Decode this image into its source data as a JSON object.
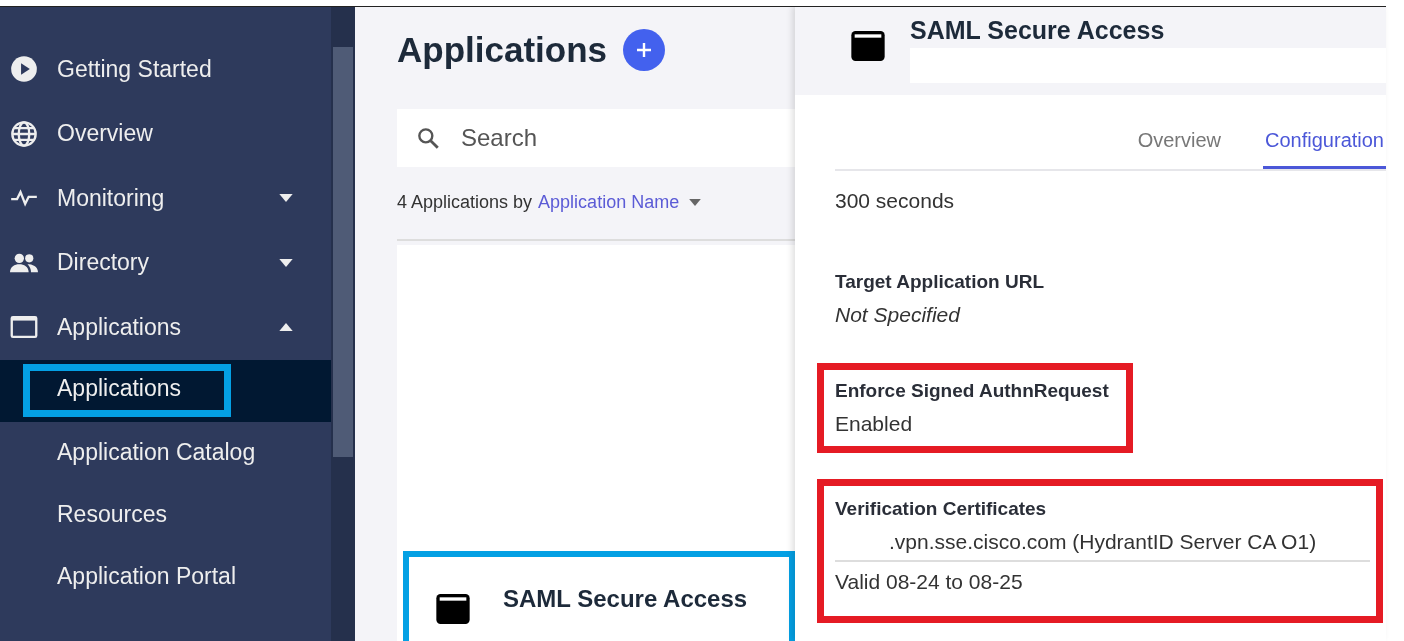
{
  "sidebar": {
    "items": [
      {
        "kind": "section",
        "label": "Getting Started"
      },
      {
        "kind": "section",
        "label": "Overview"
      },
      {
        "kind": "section",
        "label": "Monitoring",
        "expanded": false
      },
      {
        "kind": "section",
        "label": "Directory",
        "expanded": false
      },
      {
        "kind": "section",
        "label": "Applications",
        "expanded": true
      },
      {
        "kind": "subitem",
        "label": "Applications",
        "selected": true,
        "highlighted": true
      },
      {
        "kind": "subitem",
        "label": "Application Catalog",
        "selected": false,
        "highlighted": false
      },
      {
        "kind": "subitem",
        "label": "Resources",
        "selected": false,
        "highlighted": false
      },
      {
        "kind": "subitem",
        "label": "Application Portal",
        "selected": false,
        "highlighted": false
      }
    ]
  },
  "applications": {
    "title": "Applications",
    "search": {
      "placeholder": "Search"
    },
    "count_text": "4 Applications by",
    "sort_by": "Application Name",
    "cards": [
      {
        "name": "SAML Secure Access",
        "highlighted": true
      }
    ]
  },
  "detail": {
    "title": "SAML Secure Access",
    "tabs": [
      {
        "label": "Overview",
        "selected": false
      },
      {
        "label": "Configuration",
        "selected": true
      }
    ],
    "fields": [
      {
        "value": "300 seconds",
        "italic": false,
        "highlighted": false
      },
      {
        "label": "Target Application URL",
        "value": "Not Specified",
        "italic": true,
        "highlighted": false
      },
      {
        "label": "Enforce Signed AuthnRequest",
        "value": "Enabled",
        "italic": false,
        "highlighted": true
      },
      {
        "label": "Verification Certificates",
        "value": ".vpn.sse.cisco.com (HydrantID Server CA O1)",
        "note": "Valid 08-24 to 08-25",
        "italic": false,
        "highlighted": true
      }
    ]
  }
}
